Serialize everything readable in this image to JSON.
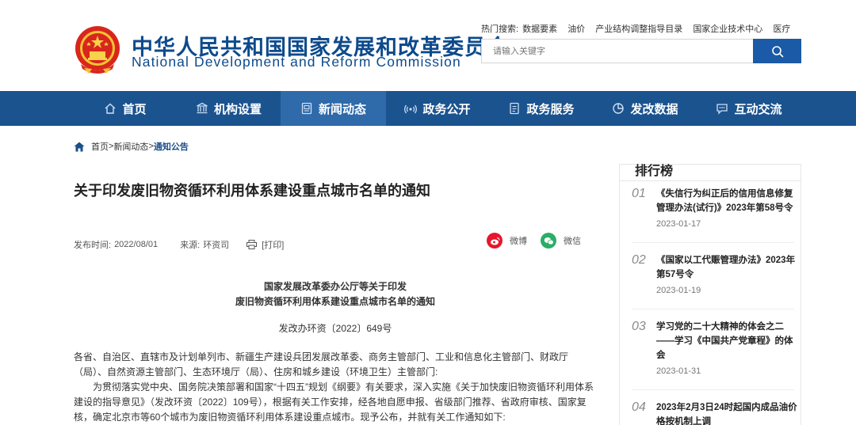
{
  "site": {
    "name_cn": "中华人民共和国国家发展和改革委员会",
    "name_en": "National Development and Reform Commission"
  },
  "hot_search": {
    "label": "热门搜索:",
    "items": [
      "数据要素",
      "油价",
      "产业结构调整指导目录",
      "国家企业技术中心",
      "医疗"
    ]
  },
  "search": {
    "placeholder": "请输入关键字"
  },
  "nav": {
    "items": [
      {
        "label": "首页",
        "icon": "home-icon"
      },
      {
        "label": "机构设置",
        "icon": "institution-icon"
      },
      {
        "label": "新闻动态",
        "icon": "news-icon"
      },
      {
        "label": "政务公开",
        "icon": "broadcast-icon"
      },
      {
        "label": "政务服务",
        "icon": "document-icon"
      },
      {
        "label": "发改数据",
        "icon": "pie-chart-icon"
      },
      {
        "label": "互动交流",
        "icon": "chat-icon"
      }
    ],
    "active_index": 2
  },
  "breadcrumb": {
    "home": "首页",
    "sep": ">",
    "level1": "新闻动态",
    "current": "通知公告"
  },
  "article": {
    "title": "关于印发废旧物资循环利用体系建设重点城市名单的通知",
    "publish_label": "发布时间:",
    "publish_date": "2022/08/01",
    "source_label": "来源:",
    "source": "环资司",
    "print_label": "[打印]",
    "share_weibo": "微博",
    "share_wechat": "微信",
    "doc_head_1": "国家发展改革委办公厅等关于印发",
    "doc_head_2": "废旧物资循环利用体系建设重点城市名单的通知",
    "doc_number": "发改办环资〔2022〕649号",
    "lines": [
      "各省、自治区、直辖市及计划单列市、新疆生产建设兵团发展改革委、商务主管部门、工业和信息化主管部门、财政厅",
      "（局）、自然资源主管部门、生态环境厅（局）、住房和城乡建设（环境卫生）主管部门:",
      "　　为贯彻落实党中央、国务院决策部署和国家“十四五”规划《纲要》有关要求，深入实施《关于加快废旧物资循环利用体系",
      "建设的指导意见》（发改环资〔2022〕109号），根据有关工作安排，经各地自愿申报、省级部门推荐、省政府审核、国家复",
      "核，确定北京市等60个城市为废旧物资循环利用体系建设重点城市。现予公布，并就有关工作通知如下:"
    ]
  },
  "ranking": {
    "title": "排行榜",
    "items": [
      {
        "num": "01",
        "line1": "《失信行为纠正后的信用信息修复",
        "line2": "管理办法(试行)》2023年第58号令",
        "line3": "",
        "date": "2023-01-17"
      },
      {
        "num": "02",
        "line1": "《国家以工代赈管理办法》2023年",
        "line2": "第57号令",
        "line3": "",
        "date": "2023-01-19"
      },
      {
        "num": "03",
        "line1": "学习党的二十大精神的体会之二",
        "line2": "——学习《中国共产党章程》的体",
        "line3": "会",
        "date": "2023-01-31"
      },
      {
        "num": "04",
        "line1": "2023年2月3日24时起国内成品油价",
        "line2": "格按机制上调",
        "line3": "",
        "date": ""
      }
    ]
  },
  "colors": {
    "brand_blue": "#0d4a8c",
    "nav_bg": "#1b538f",
    "nav_active": "#2f6aaa",
    "weibo_red": "#e6162d",
    "wechat_green": "#2aae67"
  }
}
